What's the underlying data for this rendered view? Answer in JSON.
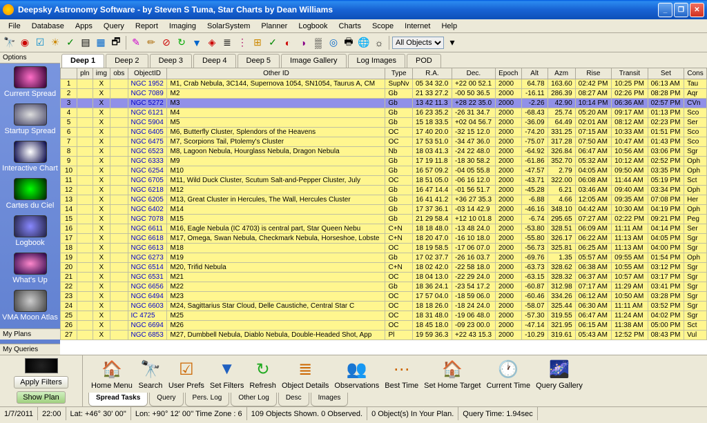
{
  "window": {
    "title": "Deepsky Astronomy Software - by Steven S Tuma, Star Charts by Dean Williams"
  },
  "menu": [
    "File",
    "Database",
    "Apps",
    "Query",
    "Report",
    "Imaging",
    "SolarSystem",
    "Planner",
    "Logbook",
    "Charts",
    "Scope",
    "Internet",
    "Help"
  ],
  "objselector": "All Objects",
  "sidebar": {
    "header": "Options",
    "items": [
      {
        "label": "Current Spread",
        "bg": "radial-gradient(circle,#ff6ec7,#330033)"
      },
      {
        "label": "Startup Spread",
        "bg": "radial-gradient(ellipse,#ddd,#446)"
      },
      {
        "label": "Interactive Chart",
        "bg": "radial-gradient(circle,#fff,#004)"
      },
      {
        "label": "Cartes du Ciel",
        "bg": "radial-gradient(circle,#0f0,#020)"
      },
      {
        "label": "Logbook",
        "bg": "radial-gradient(circle,#88f,#224)"
      },
      {
        "label": "What's Up",
        "bg": "radial-gradient(ellipse,#f8c,#204)"
      },
      {
        "label": "VMA Moon Atlas",
        "bg": "radial-gradient(circle,#ccc,#444)"
      }
    ],
    "footers": [
      "My Plans",
      "My Queries"
    ]
  },
  "tabs": [
    "Deep 1",
    "Deep 2",
    "Deep 3",
    "Deep 4",
    "Deep 5",
    "Image Gallery",
    "Log Images",
    "POD"
  ],
  "columns": [
    "",
    "pln",
    "img",
    "obs",
    "ObjectID",
    "Other ID",
    "Type",
    "R.A.",
    "Dec.",
    "Epoch",
    "Alt",
    "Azm",
    "Rise",
    "Transit",
    "Set",
    "Cons"
  ],
  "rows": [
    {
      "n": 1,
      "obj": "NGC 1952",
      "other": "M1, Crab Nebula, 3C144, Supernova 1054, SN1054, Taurus A, CM",
      "type": "SupNv",
      "ra": "05 34 32.0",
      "dec": "+22 00 52.1",
      "ep": "2000",
      "alt": "64.78",
      "azm": "163.60",
      "rise": "02:42 PM",
      "tr": "10:25 PM",
      "set": "06:13 AM",
      "con": "Tau"
    },
    {
      "n": 2,
      "obj": "NGC 7089",
      "other": "M2",
      "type": "Gb",
      "ra": "21 33 27.2",
      "dec": "-00 50 36.5",
      "ep": "2000",
      "alt": "-16.11",
      "azm": "286.39",
      "rise": "08:27 AM",
      "tr": "02:26 PM",
      "set": "08:28 PM",
      "con": "Aqr"
    },
    {
      "n": 3,
      "sel": true,
      "obj": "NGC 5272",
      "other": "M3",
      "type": "Gb",
      "ra": "13 42 11.3",
      "dec": "+28 22 35.0",
      "ep": "2000",
      "alt": "-2.26",
      "azm": "42.90",
      "rise": "10:14 PM",
      "tr": "06:36 AM",
      "set": "02:57 PM",
      "con": "CVn"
    },
    {
      "n": 4,
      "obj": "NGC 6121",
      "other": "M4",
      "type": "Gb",
      "ra": "16 23 35.2",
      "dec": "-26 31 34.7",
      "ep": "2000",
      "alt": "-68.43",
      "azm": "25.74",
      "rise": "05:20 AM",
      "tr": "09:17 AM",
      "set": "01:13 PM",
      "con": "Sco"
    },
    {
      "n": 5,
      "obj": "NGC 5904",
      "other": "M5",
      "type": "Gb",
      "ra": "15 18 33.5",
      "dec": "+02 04 56.7",
      "ep": "2000",
      "alt": "-36.09",
      "azm": "64.49",
      "rise": "02:01 AM",
      "tr": "08:12 AM",
      "set": "02:23 PM",
      "con": "Ser"
    },
    {
      "n": 6,
      "obj": "NGC 6405",
      "other": "M6, Butterfly Cluster, Splendors of the Heavens",
      "type": "OC",
      "ra": "17 40 20.0",
      "dec": "-32 15 12.0",
      "ep": "2000",
      "alt": "-74.20",
      "azm": "331.25",
      "rise": "07:15 AM",
      "tr": "10:33 AM",
      "set": "01:51 PM",
      "con": "Sco"
    },
    {
      "n": 7,
      "obj": "NGC 6475",
      "other": "M7, Scorpions Tail, Ptolemy's Cluster",
      "type": "OC",
      "ra": "17 53 51.0",
      "dec": "-34 47 36.0",
      "ep": "2000",
      "alt": "-75.07",
      "azm": "317.28",
      "rise": "07:50 AM",
      "tr": "10:47 AM",
      "set": "01:43 PM",
      "con": "Sco"
    },
    {
      "n": 8,
      "obj": "NGC 6523",
      "other": "M8, Lagoon Nebula, Hourglass Nebula, Dragon Nebula",
      "type": "Nb",
      "ra": "18 03 41.3",
      "dec": "-24 22 48.0",
      "ep": "2000",
      "alt": "-64.92",
      "azm": "326.84",
      "rise": "06:47 AM",
      "tr": "10:56 AM",
      "set": "03:06 PM",
      "con": "Sgr"
    },
    {
      "n": 9,
      "obj": "NGC 6333",
      "other": "M9",
      "type": "Gb",
      "ra": "17 19 11.8",
      "dec": "-18 30 58.2",
      "ep": "2000",
      "alt": "-61.86",
      "azm": "352.70",
      "rise": "05:32 AM",
      "tr": "10:12 AM",
      "set": "02:52 PM",
      "con": "Oph"
    },
    {
      "n": 10,
      "obj": "NGC 6254",
      "other": "M10",
      "type": "Gb",
      "ra": "16 57 09.2",
      "dec": "-04 05 55.8",
      "ep": "2000",
      "alt": "-47.57",
      "azm": "2.79",
      "rise": "04:05 AM",
      "tr": "09:50 AM",
      "set": "03:35 PM",
      "con": "Oph"
    },
    {
      "n": 11,
      "obj": "NGC 6705",
      "other": "M11, Wild Duck Cluster, Scutum Salt-and-Pepper Cluster, July",
      "type": "OC",
      "ra": "18 51 05.0",
      "dec": "-06 16 12.0",
      "ep": "2000",
      "alt": "-43.71",
      "azm": "322.00",
      "rise": "06:08 AM",
      "tr": "11:44 AM",
      "set": "05:19 PM",
      "con": "Sct"
    },
    {
      "n": 12,
      "obj": "NGC 6218",
      "other": "M12",
      "type": "Gb",
      "ra": "16 47 14.4",
      "dec": "-01 56 51.7",
      "ep": "2000",
      "alt": "-45.28",
      "azm": "6.21",
      "rise": "03:46 AM",
      "tr": "09:40 AM",
      "set": "03:34 PM",
      "con": "Oph"
    },
    {
      "n": 13,
      "obj": "NGC 6205",
      "other": "M13, Great Cluster in Hercules, The Wall, Hercules Cluster",
      "type": "Gb",
      "ra": "16 41 41.2",
      "dec": "+36 27 35.3",
      "ep": "2000",
      "alt": "-6.88",
      "azm": "4.66",
      "rise": "12:05 AM",
      "tr": "09:35 AM",
      "set": "07:08 PM",
      "con": "Her"
    },
    {
      "n": 14,
      "obj": "NGC 6402",
      "other": "M14",
      "type": "Gb",
      "ra": "17 37 36.1",
      "dec": "-03 14 42.9",
      "ep": "2000",
      "alt": "-46.16",
      "azm": "348.10",
      "rise": "04:42 AM",
      "tr": "10:30 AM",
      "set": "04:19 PM",
      "con": "Oph"
    },
    {
      "n": 15,
      "obj": "NGC 7078",
      "other": "M15",
      "type": "Gb",
      "ra": "21 29 58.4",
      "dec": "+12 10 01.8",
      "ep": "2000",
      "alt": "-6.74",
      "azm": "295.65",
      "rise": "07:27 AM",
      "tr": "02:22 PM",
      "set": "09:21 PM",
      "con": "Peg"
    },
    {
      "n": 16,
      "obj": "NGC 6611",
      "other": "M16, Eagle Nebula (IC 4703) is central part, Star Queen Nebu",
      "type": "C+N",
      "ra": "18 18 48.0",
      "dec": "-13 48 24.0",
      "ep": "2000",
      "alt": "-53.80",
      "azm": "328.51",
      "rise": "06:09 AM",
      "tr": "11:11 AM",
      "set": "04:14 PM",
      "con": "Ser"
    },
    {
      "n": 17,
      "obj": "NGC 6618",
      "other": "M17, Omega, Swan Nebula, Checkmark Nebula, Horseshoe, Lobste",
      "type": "C+N",
      "ra": "18 20 47.0",
      "dec": "-16 10 18.0",
      "ep": "2000",
      "alt": "-55.80",
      "azm": "326.17",
      "rise": "06:22 AM",
      "tr": "11:13 AM",
      "set": "04:05 PM",
      "con": "Sgr"
    },
    {
      "n": 18,
      "obj": "NGC 6613",
      "other": "M18",
      "type": "OC",
      "ra": "18 19 58.5",
      "dec": "-17 06 07.0",
      "ep": "2000",
      "alt": "-56.73",
      "azm": "325.81",
      "rise": "06:25 AM",
      "tr": "11:13 AM",
      "set": "04:00 PM",
      "con": "Sgr"
    },
    {
      "n": 19,
      "obj": "NGC 6273",
      "other": "M19",
      "type": "Gb",
      "ra": "17 02 37.7",
      "dec": "-26 16 03.7",
      "ep": "2000",
      "alt": "-69.76",
      "azm": "1.35",
      "rise": "05:57 AM",
      "tr": "09:55 AM",
      "set": "01:54 PM",
      "con": "Oph"
    },
    {
      "n": 20,
      "obj": "NGC 6514",
      "other": "M20, Trifid Nebula",
      "type": "C+N",
      "ra": "18 02 42.0",
      "dec": "-22 58 18.0",
      "ep": "2000",
      "alt": "-63.73",
      "azm": "328.62",
      "rise": "06:38 AM",
      "tr": "10:55 AM",
      "set": "03:12 PM",
      "con": "Sgr"
    },
    {
      "n": 21,
      "obj": "NGC 6531",
      "other": "M21",
      "type": "OC",
      "ra": "18 04 13.0",
      "dec": "-22 29 24.0",
      "ep": "2000",
      "alt": "-63.15",
      "azm": "328.32",
      "rise": "06:37 AM",
      "tr": "10:57 AM",
      "set": "03:17 PM",
      "con": "Sgr"
    },
    {
      "n": 22,
      "obj": "NGC 6656",
      "other": "M22",
      "type": "Gb",
      "ra": "18 36 24.1",
      "dec": "-23 54 17.2",
      "ep": "2000",
      "alt": "-60.87",
      "azm": "312.98",
      "rise": "07:17 AM",
      "tr": "11:29 AM",
      "set": "03:41 PM",
      "con": "Sgr"
    },
    {
      "n": 23,
      "obj": "NGC 6494",
      "other": "M23",
      "type": "OC",
      "ra": "17 57 04.0",
      "dec": "-18 59 06.0",
      "ep": "2000",
      "alt": "-60.46",
      "azm": "334.26",
      "rise": "06:12 AM",
      "tr": "10:50 AM",
      "set": "03:28 PM",
      "con": "Sgr"
    },
    {
      "n": 24,
      "obj": "NGC 6603",
      "other": "M24, Sagittarius Star Cloud, Delle Caustiche, Central Star C",
      "type": "OC",
      "ra": "18 18 26.0",
      "dec": "-18 24 24.0",
      "ep": "2000",
      "alt": "-58.07",
      "azm": "325.44",
      "rise": "06:30 AM",
      "tr": "11:11 AM",
      "set": "03:52 PM",
      "con": "Sgr"
    },
    {
      "n": 25,
      "obj": "IC 4725",
      "other": "M25",
      "type": "OC",
      "ra": "18 31 48.0",
      "dec": "-19 06 48.0",
      "ep": "2000",
      "alt": "-57.30",
      "azm": "319.55",
      "rise": "06:47 AM",
      "tr": "11:24 AM",
      "set": "04:02 PM",
      "con": "Sgr"
    },
    {
      "n": 26,
      "obj": "NGC 6694",
      "other": "M26",
      "type": "OC",
      "ra": "18 45 18.0",
      "dec": "-09 23 00.0",
      "ep": "2000",
      "alt": "-47.14",
      "azm": "321.95",
      "rise": "06:15 AM",
      "tr": "11:38 AM",
      "set": "05:00 PM",
      "con": "Sct"
    },
    {
      "n": 27,
      "obj": "NGC 6853",
      "other": "M27, Dumbbell Nebula, Diablo Nebula, Double-Headed Shot, App",
      "type": "Pl",
      "ra": "19 59 36.3",
      "dec": "+22 43 15.3",
      "ep": "2000",
      "alt": "-10.29",
      "azm": "319.61",
      "rise": "05:43 AM",
      "tr": "12:52 PM",
      "set": "08:43 PM",
      "con": "Vul"
    }
  ],
  "bottom": {
    "applyfilters": "Apply Filters",
    "showplan": "Show Plan",
    "bigicons": [
      {
        "label": "Home Menu",
        "icon": "🏠"
      },
      {
        "label": "Search",
        "icon": "🔭"
      },
      {
        "label": "User Prefs",
        "icon": "☑"
      },
      {
        "label": "Set Filters",
        "icon": "▼",
        "color": "#2060c0"
      },
      {
        "label": "Refresh",
        "icon": "↻",
        "color": "#2a2"
      },
      {
        "label": "Object Details",
        "icon": "≣"
      },
      {
        "label": "Observations",
        "icon": "👥"
      },
      {
        "label": "Best Time",
        "icon": "⋯"
      },
      {
        "label": "Set Home Target",
        "icon": "🏠"
      },
      {
        "label": "Current Time",
        "icon": "🕐"
      },
      {
        "label": "Query Gallery",
        "icon": "🌌"
      }
    ],
    "spreadtabs": [
      "Spread Tasks",
      "Query",
      "Pers. Log",
      "Other Log",
      "Desc",
      "Images"
    ]
  },
  "status": {
    "date": "1/7/2011",
    "time": "22:00",
    "lat": "Lat: +46° 30' 00''",
    "lon": "Lon: +90° 12' 00''  Time Zone : 6",
    "objs": "109 Objects Shown. 0 Observed.",
    "plan": "0 Object(s) In Your Plan.",
    "qtime": "Query Time: 1.94sec"
  }
}
